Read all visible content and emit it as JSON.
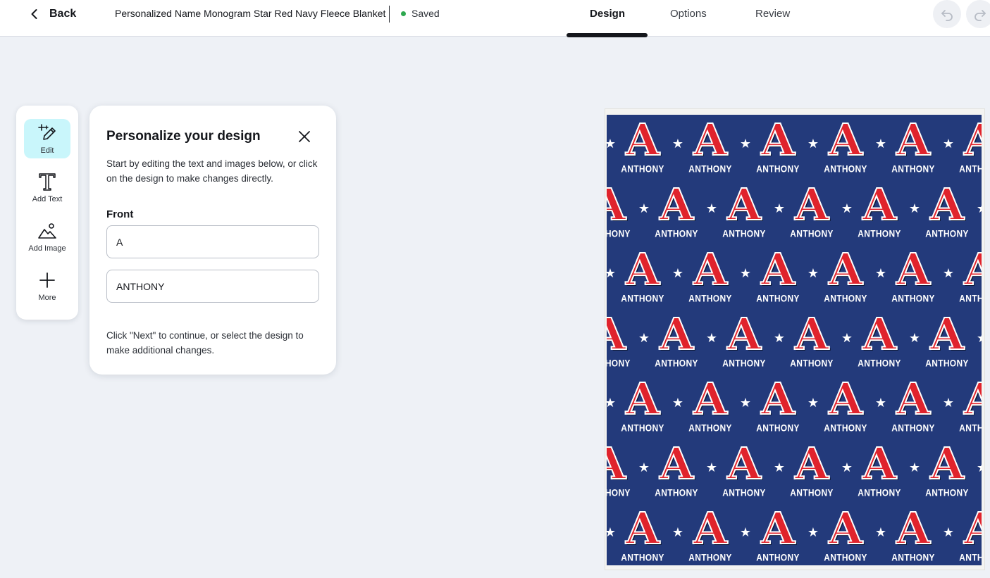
{
  "header": {
    "back_label": "Back",
    "product_title": "Personalized Name Monogram Star Red Navy Fleece Blanket",
    "save_status": "Saved",
    "tabs": [
      {
        "label": "Design",
        "active": true
      },
      {
        "label": "Options",
        "active": false
      },
      {
        "label": "Review",
        "active": false
      }
    ],
    "undo_icon": "undo-icon",
    "redo_icon": "redo-icon"
  },
  "rail": {
    "items": [
      {
        "label": "Edit",
        "icon": "pencil-sparkle-icon",
        "active": true
      },
      {
        "label": "Add Text",
        "icon": "text-t-icon",
        "active": false
      },
      {
        "label": "Add Image",
        "icon": "image-mountain-icon",
        "active": false
      },
      {
        "label": "More",
        "icon": "plus-icon",
        "active": false
      }
    ]
  },
  "panel": {
    "title": "Personalize your design",
    "intro": "Start by editing the text and images below, or click on the design to make changes directly.",
    "section_label": "Front",
    "fields": [
      {
        "value": "A"
      },
      {
        "value": "ANTHONY"
      }
    ],
    "footer": "Click \"Next\" to continue, or select the design to make additional changes."
  },
  "design": {
    "monogram": "A",
    "name": "ANTHONY",
    "colors": {
      "background": "#233a7b",
      "letter": "#e0232c",
      "text": "#ffffff"
    }
  },
  "colors": {
    "accent_active": "#c9f6fb",
    "saved_dot": "#2ea84f"
  }
}
